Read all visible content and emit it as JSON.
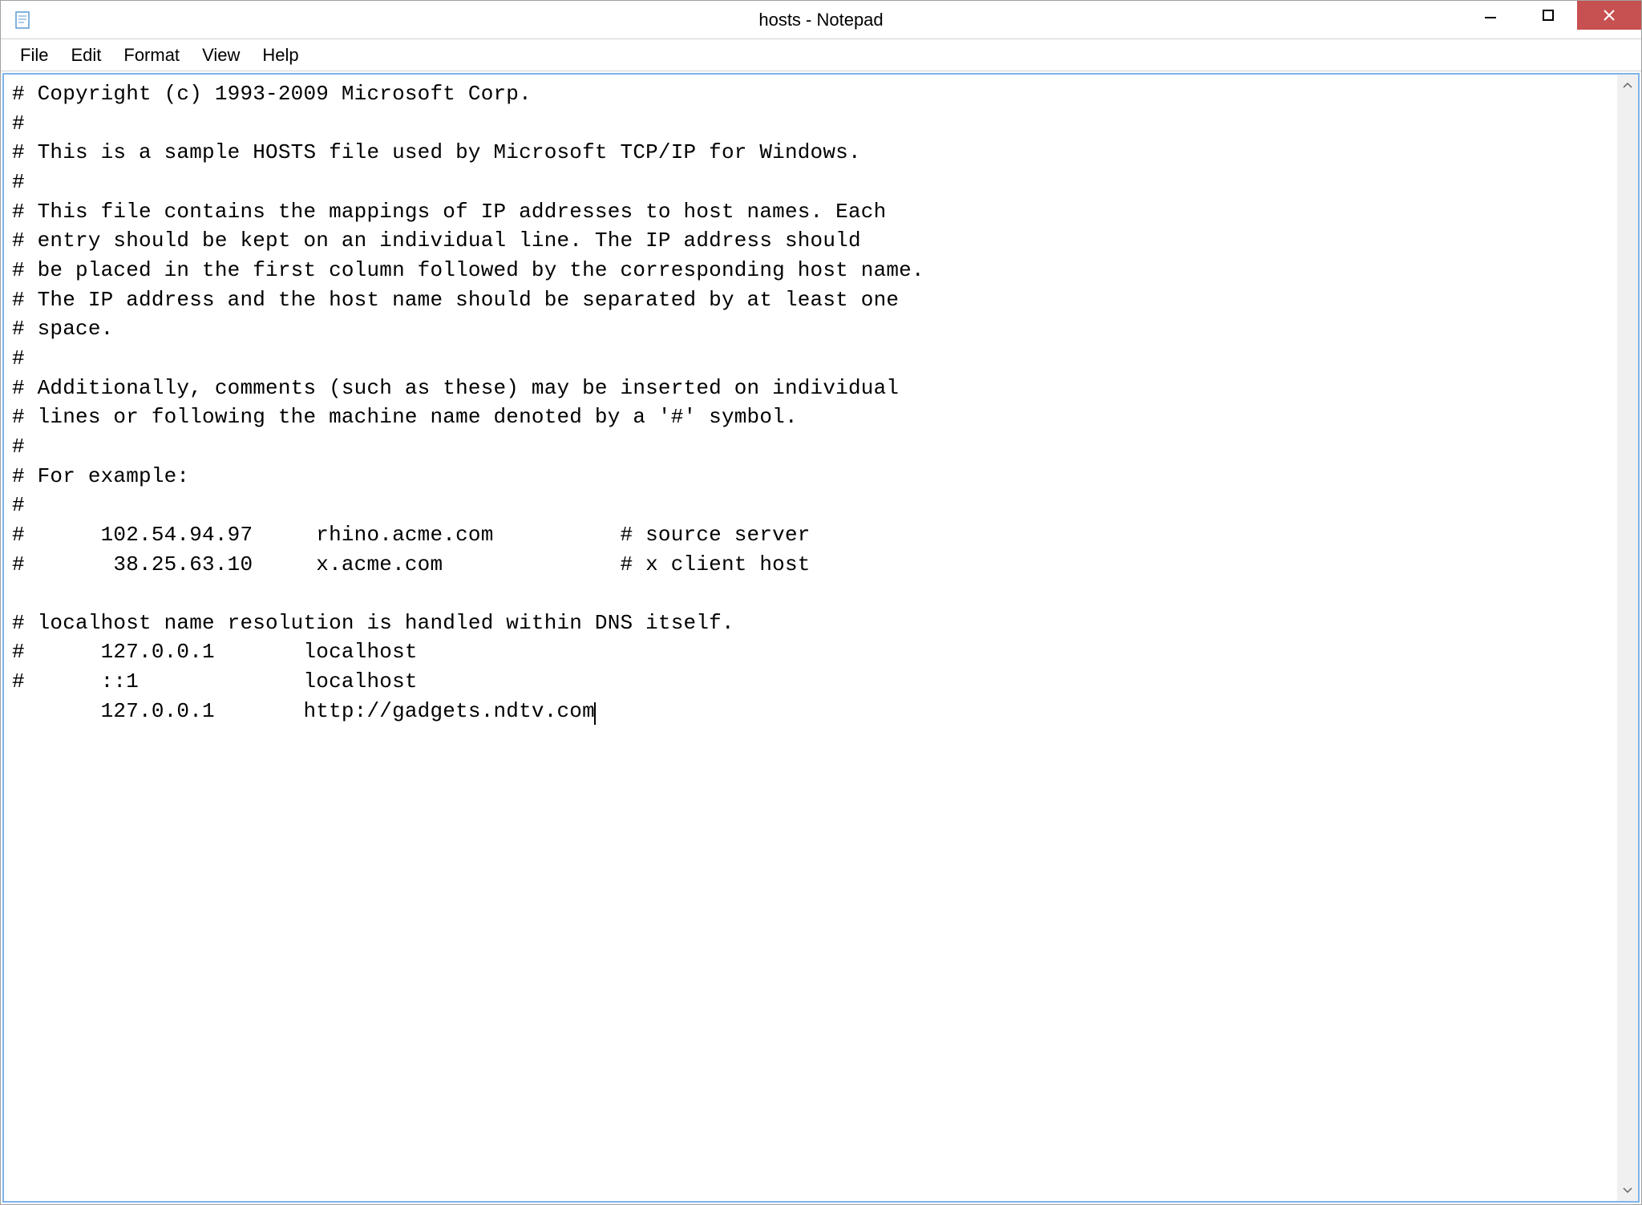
{
  "titlebar": {
    "title": "hosts - Notepad"
  },
  "menubar": {
    "file": "File",
    "edit": "Edit",
    "format": "Format",
    "view": "View",
    "help": "Help"
  },
  "editor": {
    "content": "# Copyright (c) 1993-2009 Microsoft Corp.\n#\n# This is a sample HOSTS file used by Microsoft TCP/IP for Windows.\n#\n# This file contains the mappings of IP addresses to host names. Each\n# entry should be kept on an individual line. The IP address should\n# be placed in the first column followed by the corresponding host name.\n# The IP address and the host name should be separated by at least one\n# space.\n#\n# Additionally, comments (such as these) may be inserted on individual\n# lines or following the machine name denoted by a '#' symbol.\n#\n# For example:\n#\n#      102.54.94.97     rhino.acme.com          # source server\n#       38.25.63.10     x.acme.com              # x client host\n\n# localhost name resolution is handled within DNS itself.\n#      127.0.0.1       localhost\n#      ::1             localhost\n       127.0.0.1       http://gadgets.ndtv.com"
  }
}
